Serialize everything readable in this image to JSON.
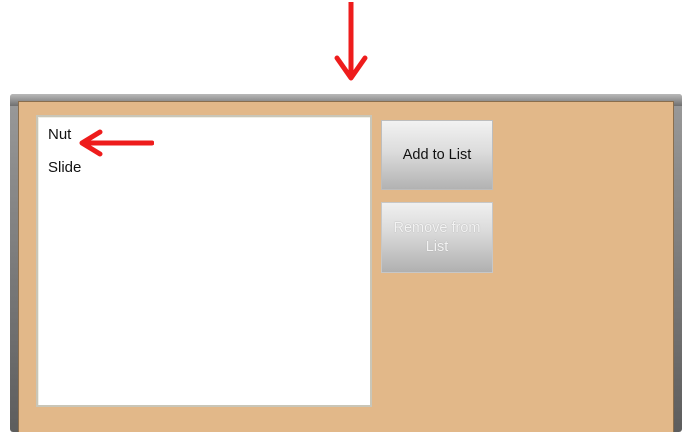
{
  "list": {
    "items": [
      "Nut",
      "Slide"
    ]
  },
  "buttons": {
    "add_label": "Add to List",
    "remove_label": "Remove from List"
  },
  "colors": {
    "panel_background": "#e2b889",
    "frame": "#6f6f6f",
    "annotation_arrow": "#ee1c1c"
  },
  "annotations": {
    "top_arrow_icon": "arrow-down-icon",
    "list_arrow_icon": "arrow-left-icon"
  }
}
